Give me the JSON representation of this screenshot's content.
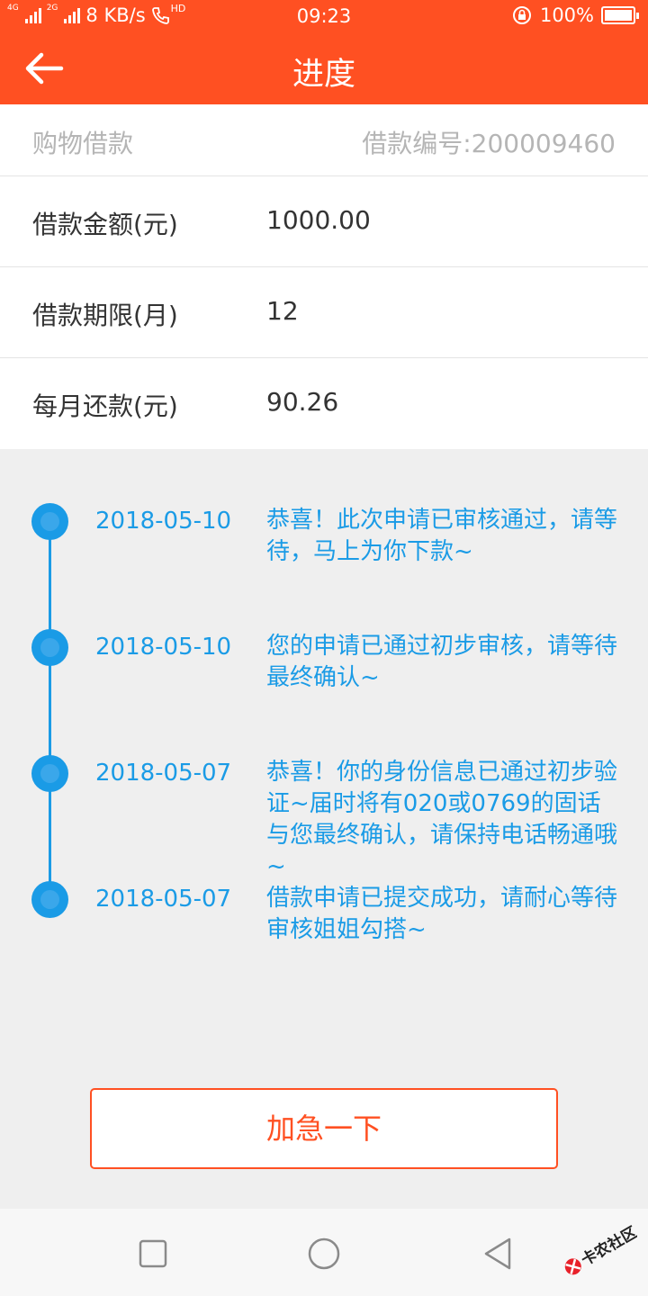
{
  "status_bar": {
    "net1": "4G",
    "net2": "2G",
    "speed": "8 KB/s",
    "hd": "HD",
    "time": "09:23",
    "battery": "100%"
  },
  "header": {
    "title": "进度"
  },
  "loan": {
    "type": "购物借款",
    "number": "借款编号:200009460",
    "rows": [
      {
        "label": "借款金额(元)",
        "value": "1000.00"
      },
      {
        "label": "借款期限(月)",
        "value": "12"
      },
      {
        "label": "每月还款(元)",
        "value": "90.26"
      }
    ]
  },
  "timeline": [
    {
      "date": "2018-05-10",
      "text": "恭喜！此次申请已审核通过，请等待，马上为你下款~"
    },
    {
      "date": "2018-05-10",
      "text": "您的申请已通过初步审核，请等待最终确认~"
    },
    {
      "date": "2018-05-07",
      "text": "恭喜！你的身份信息已通过初步验证~届时将有020或0769的固话与您最终确认，请保持电话畅通哦~"
    },
    {
      "date": "2018-05-07",
      "text": "借款申请已提交成功，请耐心等待审核姐姐勾搭~"
    }
  ],
  "actions": {
    "urge_label": "加急一下"
  },
  "watermark": {
    "text": "卡农社区"
  },
  "colors": {
    "primary": "#ff5022",
    "timeline": "#1a9be6"
  }
}
